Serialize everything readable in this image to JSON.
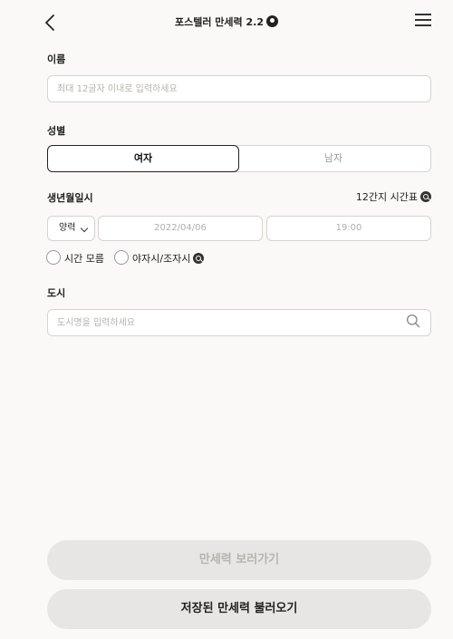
{
  "header": {
    "title": "포스텔러 만세력 2.2",
    "back_icon": "chevron-left-icon",
    "menu_icon": "hamburger-menu-icon"
  },
  "name": {
    "label": "이름",
    "placeholder": "최대 12글자 이내로 입력하세요",
    "value": ""
  },
  "gender": {
    "label": "성별",
    "options": [
      "여자",
      "남자"
    ],
    "selected": "여자"
  },
  "birth": {
    "label": "생년월일시",
    "table_link": "12간지 시간표",
    "calendar_type": "양력",
    "date": "2022/04/06",
    "time": "19:00",
    "unknown_time_label": "시간 모름",
    "yajasi_label": "야자시/조자시"
  },
  "city": {
    "label": "도시",
    "placeholder": "도시명을 입력하세요",
    "value": ""
  },
  "buttons": {
    "view": "만세력 보러가기",
    "load": "저장된 만세력 불러오기"
  }
}
